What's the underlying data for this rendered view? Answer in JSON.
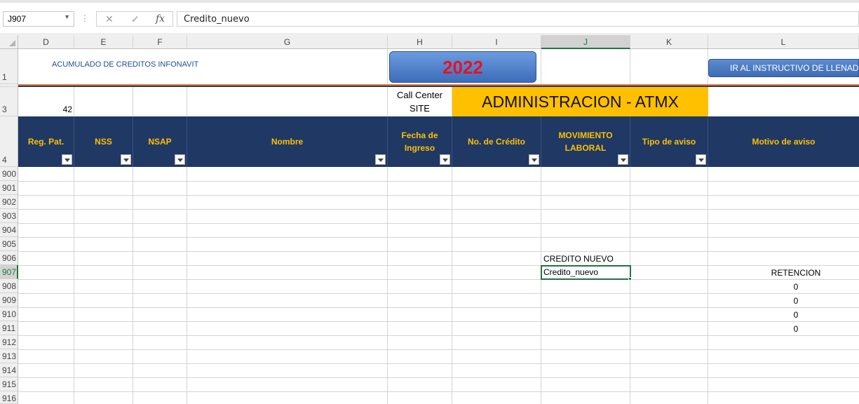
{
  "formula_bar": {
    "name_box": "J907",
    "formula_value": "Credito_nuevo",
    "cancel_icon": "close-icon",
    "enter_icon": "check-icon",
    "fx_label": "fx"
  },
  "columns": [
    "D",
    "E",
    "F",
    "G",
    "H",
    "I",
    "J",
    "K",
    "L"
  ],
  "rows": [
    "1",
    "3",
    "4",
    "900",
    "901",
    "902",
    "903",
    "904",
    "905",
    "906",
    "907",
    "908",
    "909",
    "910",
    "911",
    "912",
    "913",
    "914",
    "915",
    "916"
  ],
  "sheet": {
    "title": "ACUMULADO DE CREDITOS INFONAVIT",
    "year_button": "2022",
    "instructions_button": "IR AL INSTRUCTIVO DE LLENADO",
    "count_value": "42",
    "call_center_label": "Call Center",
    "site_label": "SITE",
    "admin_banner": "ADMINISTRACION - ATMX"
  },
  "table_headers": [
    "Reg. Pat.",
    "NSS",
    "NSAP",
    "Nombre",
    "Fecha de Ingreso",
    "No. de Crédito",
    "MOVIMIENTO LABORAL",
    "Tipo de aviso",
    "Motivo de aviso"
  ],
  "cells": {
    "j906": "CREDITO NUEVO",
    "j907": "Credito_nuevo",
    "l907": "RETENCION",
    "l908": "0",
    "l909": "0",
    "l910": "0",
    "l911": "0"
  },
  "colors": {
    "header_fill": "#1f3864",
    "header_text": "#ffc000",
    "banner_fill": "#ffc000",
    "year_text": "#e81123",
    "button_fill": "#4a7bc4",
    "selection": "#217346"
  }
}
